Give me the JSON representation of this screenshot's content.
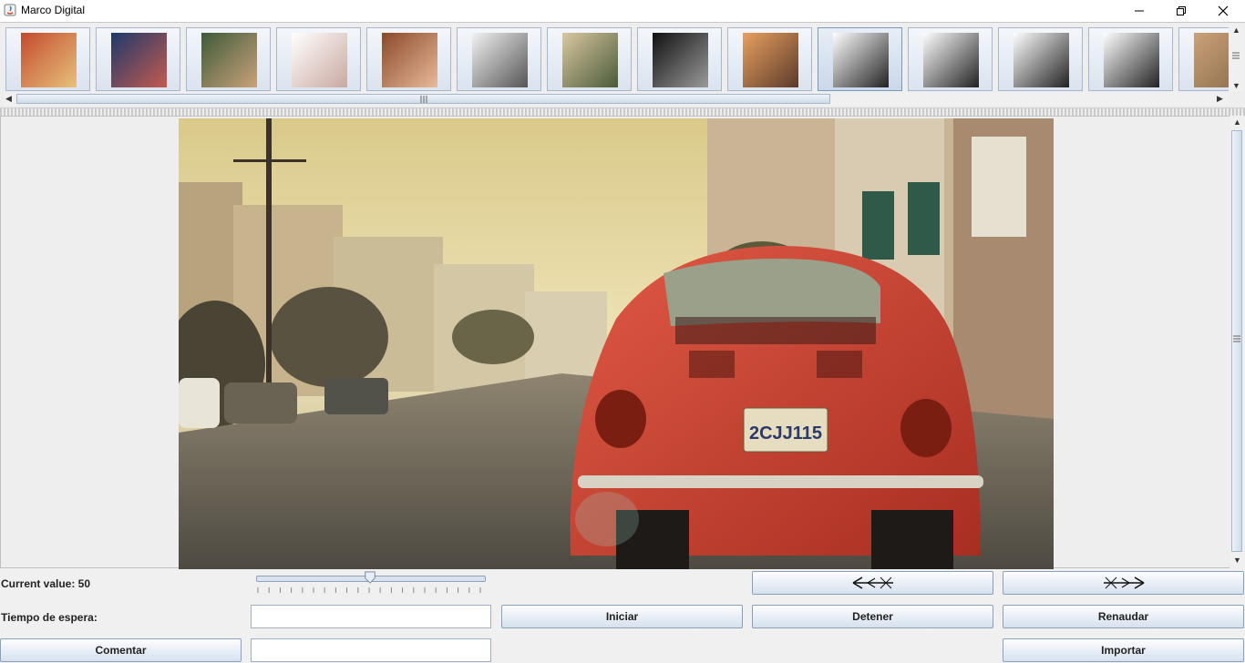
{
  "window": {
    "title": "Marco Digital"
  },
  "thumbnails": [
    {
      "name": "thumb-red-beetle",
      "colors": [
        "#c44a2f",
        "#e6c27a"
      ]
    },
    {
      "name": "thumb-stormy-sky",
      "colors": [
        "#1e3a6a",
        "#c45a50"
      ]
    },
    {
      "name": "thumb-woman-forest",
      "colors": [
        "#3f5a3a",
        "#caa27a"
      ]
    },
    {
      "name": "thumb-sketch",
      "colors": [
        "#ffffff",
        "#c7a9a0"
      ]
    },
    {
      "name": "thumb-couple",
      "colors": [
        "#8a4a2a",
        "#e8b99a"
      ]
    },
    {
      "name": "thumb-drawing",
      "colors": [
        "#f2f2f2",
        "#555555"
      ]
    },
    {
      "name": "thumb-couple-field",
      "colors": [
        "#d8c8a0",
        "#4a5a3a"
      ]
    },
    {
      "name": "thumb-bw-collage",
      "colors": [
        "#111111",
        "#9a9a9a"
      ]
    },
    {
      "name": "thumb-sunset-collage",
      "colors": [
        "#e8a060",
        "#5a3a2a"
      ]
    },
    {
      "name": "thumb-comic-1",
      "colors": [
        "#ffffff",
        "#222222"
      ]
    },
    {
      "name": "thumb-comic-2",
      "colors": [
        "#ffffff",
        "#222222"
      ]
    },
    {
      "name": "thumb-comic-3",
      "colors": [
        "#ffffff",
        "#222222"
      ]
    },
    {
      "name": "thumb-comic-4",
      "colors": [
        "#ffffff",
        "#222222"
      ]
    },
    {
      "name": "thumb-baby",
      "colors": [
        "#caa27a",
        "#8a6a4a"
      ]
    }
  ],
  "selected_thumbnail_index": 9,
  "viewer": {
    "plate_text": "2CJJ115"
  },
  "controls": {
    "current_value_label": "Current value: 50",
    "slider_value": 50,
    "slider_min": 0,
    "slider_max": 100,
    "wait_label": "Tiempo de espera:",
    "wait_value": "",
    "start_button": "Iniciar",
    "stop_button": "Detener",
    "resume_button": "Renaudar",
    "comment_button": "Comentar",
    "comment_value": "",
    "import_button": "Importar",
    "prev_icon": "left-arrow-icon",
    "next_icon": "right-arrow-icon"
  }
}
